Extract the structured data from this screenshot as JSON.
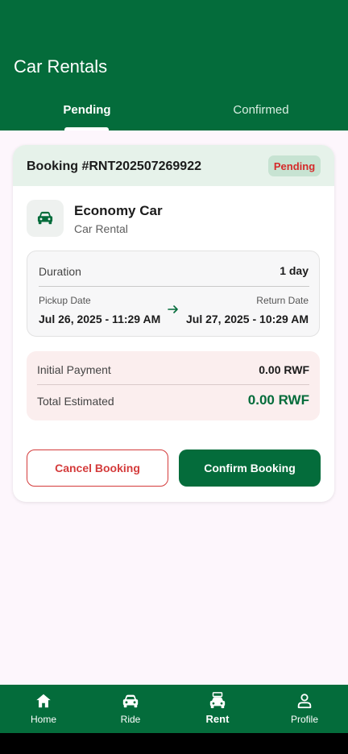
{
  "header": {
    "title": "Car Rentals",
    "tabs": [
      {
        "label": "Pending",
        "active": true
      },
      {
        "label": "Confirmed",
        "active": false
      }
    ]
  },
  "booking": {
    "id_label": "Booking #RNT202507269922",
    "status": "Pending",
    "car_name": "Economy Car",
    "car_type": "Car Rental",
    "car_icon": "car-icon",
    "duration_label": "Duration",
    "duration_value": "1 day",
    "pickup_label": "Pickup Date",
    "pickup_value": "Jul 26, 2025 - 11:29 AM",
    "return_label": "Return Date",
    "return_value": "Jul 27, 2025 - 10:29 AM",
    "initial_payment_label": "Initial Payment",
    "initial_payment_value": "0.00 RWF",
    "total_label": "Total Estimated",
    "total_value": "0.00 RWF",
    "cancel_label": "Cancel Booking",
    "confirm_label": "Confirm Booking"
  },
  "bottom_nav": {
    "items": [
      {
        "label": "Home",
        "icon": "home-icon",
        "active": false
      },
      {
        "label": "Ride",
        "icon": "car-icon",
        "active": false
      },
      {
        "label": "Rent",
        "icon": "rental-car-icon",
        "active": true
      },
      {
        "label": "Profile",
        "icon": "user-icon",
        "active": false
      }
    ]
  },
  "colors": {
    "primary": "#046c3b",
    "danger": "#d43b3b",
    "background": "#fdf6fc"
  }
}
